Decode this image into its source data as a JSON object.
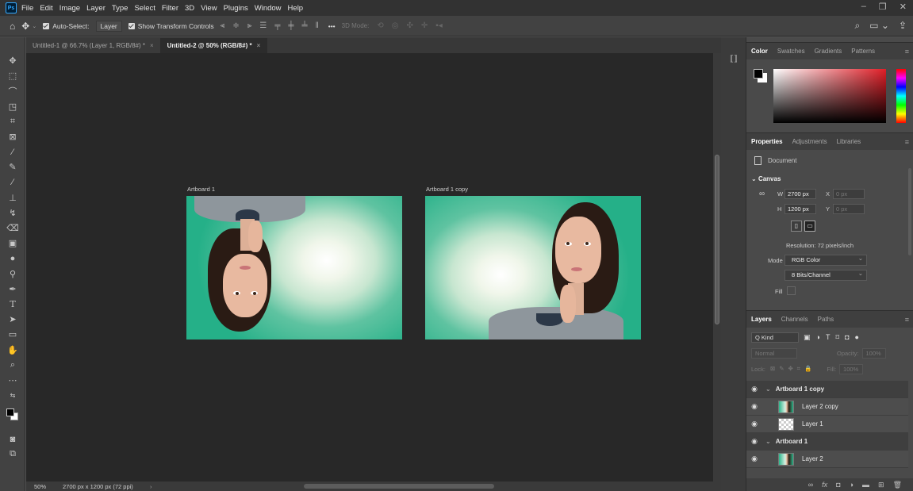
{
  "menubar": {
    "logo": "Ps",
    "items": [
      "File",
      "Edit",
      "Image",
      "Layer",
      "Type",
      "Select",
      "Filter",
      "3D",
      "View",
      "Plugins",
      "Window",
      "Help"
    ]
  },
  "options_bar": {
    "auto_select_label": "Auto-Select:",
    "auto_select_value": "Layer",
    "show_transform_label": "Show Transform Controls",
    "more_label": "•••",
    "mode3d_label": "3D Mode:"
  },
  "tabs": [
    {
      "label": "Untitled-1 @ 66.7% (Layer 1, RGB/8#) *",
      "active": false
    },
    {
      "label": "Untitled-2 @ 50% (RGB/8#) *",
      "active": true
    }
  ],
  "artboards": [
    {
      "label": "Artboard 1",
      "flipped": true
    },
    {
      "label": "Artboard 1 copy",
      "flipped": false
    }
  ],
  "status": {
    "zoom": "50%",
    "doc_info": "2700 px x 1200 px (72 ppi)"
  },
  "color_panel": {
    "tabs": [
      "Color",
      "Swatches",
      "Gradients",
      "Patterns"
    ],
    "foreground": "#000000",
    "background": "#ffffff"
  },
  "properties_panel": {
    "tabs": [
      "Properties",
      "Adjustments",
      "Libraries"
    ],
    "document_label": "Document",
    "canvas_label": "Canvas",
    "w_label": "W",
    "w_value": "2700 px",
    "h_label": "H",
    "h_value": "1200 px",
    "x_label": "X",
    "x_value": "0 px",
    "y_label": "Y",
    "y_value": "0 px",
    "resolution": "Resolution: 72 pixels/inch",
    "mode_label": "Mode",
    "mode_value": "RGB Color",
    "bits_value": "8 Bits/Channel",
    "fill_label": "Fill"
  },
  "layers_panel": {
    "tabs": [
      "Layers",
      "Channels",
      "Paths"
    ],
    "kind_label": "Q Kind",
    "blend_mode": "Normal",
    "opacity_label": "Opacity:",
    "opacity_value": "100%",
    "lock_label": "Lock:",
    "fill_label": "Fill:",
    "fill_value": "100%",
    "rows": [
      {
        "name": "Artboard 1 copy",
        "type": "group"
      },
      {
        "name": "Layer 2 copy",
        "type": "photo"
      },
      {
        "name": "Layer 1",
        "type": "transparent"
      },
      {
        "name": "Artboard 1",
        "type": "group"
      },
      {
        "name": "Layer 2",
        "type": "photo"
      }
    ]
  },
  "colors": {
    "app_bg": "#535353",
    "canvas_bg": "#282828",
    "accent": "#31a8ff",
    "artboard_green": "#25b088"
  }
}
